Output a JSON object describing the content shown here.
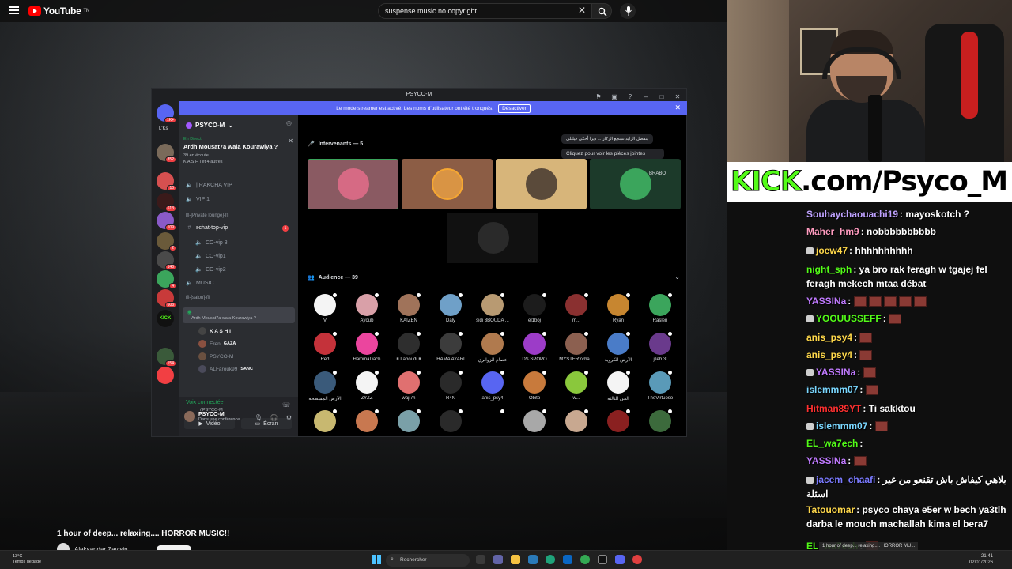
{
  "youtube": {
    "logo_text": "YouTube",
    "logo_tm": "TN",
    "search_value": "suspense music no copyright",
    "video_title": "1 hour of deep... relaxing.... HORROR MUSIC!!",
    "channel_name": "Aleksandar Zavisin"
  },
  "discord": {
    "window_title": "PSYCO-M",
    "banner_text": "Le mode streamer est activé. Les noms d'utilisateur ont été tronqués.",
    "banner_button": "Désactiver",
    "server_name": "PSYCO-M",
    "server_label": "L'Ks",
    "event_live": "En Direct",
    "event_title": "Ardh Mousat7a wala Kourawiya ?",
    "event_listening": "39 en écoute",
    "event_others": "K A S H I et 4 autres",
    "channels": [
      {
        "icon": "speaker",
        "label": "| RAKCHA VIP"
      },
      {
        "icon": "speaker",
        "label": "VIP 1"
      },
      {
        "icon": "category",
        "label": "ᗰ-[Private lounge]-ᗰ"
      },
      {
        "icon": "hash",
        "label": "ʚchat-top-vip",
        "badge": "1"
      },
      {
        "icon": "speaker",
        "label": "CO-vip 3"
      },
      {
        "icon": "speaker",
        "label": "CO-vip1"
      },
      {
        "icon": "speaker",
        "label": "CO-vip2"
      },
      {
        "icon": "speaker",
        "label": "MUSIC"
      },
      {
        "icon": "category",
        "label": "ᗰ-[salon]-ᗰ"
      }
    ],
    "stage_channel": "Ardh Mousat7a wala Kourawiya ?",
    "voice_users": [
      "K A S H I",
      "Eren",
      "PSYCO-M",
      "ALFarouk99"
    ],
    "voice_user_tags": {
      "Eren": "GAZA",
      "ALFarouk99": "SANC"
    },
    "voice_status": "Voix connectée",
    "voice_location": "/ PSYCO-M",
    "video_label": "Vidéo",
    "screen_label": "Écran",
    "user_name": "PSYCO-M",
    "user_status": "Dans une conférence",
    "speakers_title": "Intervenants — 5",
    "audience_title": "Audience — 39",
    "tooltip_arabic": "بتفصل الزايد تشجع الركاز ... ديرا أحكي فيلتلي",
    "tooltip_attach": "Cliquez pour voir les pièces jointes",
    "brabo_label": "BRABO",
    "audience": [
      {
        "name": "V",
        "color": "#f4f4f4"
      },
      {
        "name": "Ayoub",
        "color": "#d9a0a8"
      },
      {
        "name": "KAIZEN",
        "color": "#a0735a"
      },
      {
        "name": "Daly",
        "color": "#6fa0c8"
      },
      {
        "name": "sidi 3BOUDA ...",
        "color": "#b89a72"
      },
      {
        "name": "el1boj",
        "color": "#1c1c1c"
      },
      {
        "name": "m...",
        "color": "#8a3030"
      },
      {
        "name": "Ryan",
        "color": "#c78630"
      },
      {
        "name": "Raslen",
        "color": "#3ba55c"
      },
      {
        "name": "Red",
        "color": "#c4323a"
      },
      {
        "name": "HammaDach",
        "color": "#eb459e"
      },
      {
        "name": "¥ Laboudi ¥",
        "color": "#2e2e2e"
      },
      {
        "name": "HAMA AYARI",
        "color": "#3c3c3c"
      },
      {
        "name": "عصام الزوابري",
        "color": "#b07a4e"
      },
      {
        "name": "DS SPOPO",
        "color": "#9c3cc8"
      },
      {
        "name": "MYSTERYcha...",
        "color": "#8c6050"
      },
      {
        "name": "الأرض الكروية",
        "color": "#4a7cc8"
      },
      {
        "name": "jlleb 3l",
        "color": "#6a3a8c"
      },
      {
        "name": "الأرض المسطحة",
        "color": "#3a5a7a"
      },
      {
        "name": "ZYZZ",
        "color": "#f4f4f4"
      },
      {
        "name": "waji7h",
        "color": "#e07070"
      },
      {
        "name": "R4N",
        "color": "#2a2a2a"
      },
      {
        "name": "anis_psy4",
        "color": "#5865f2"
      },
      {
        "name": "Obito",
        "color": "#c87a3c"
      },
      {
        "name": "w...",
        "color": "#8ac83c"
      },
      {
        "name": "الجن الثالثة",
        "color": "#f4f4f4"
      },
      {
        "name": "TheVirtuoso",
        "color": "#5a9ab8"
      },
      {
        "name": "",
        "color": "#c8b870"
      },
      {
        "name": "",
        "color": "#c87850"
      },
      {
        "name": "",
        "color": "#7aa0a8"
      },
      {
        "name": "",
        "color": "#2a2a2a"
      },
      {
        "name": "",
        "color": "#000000"
      },
      {
        "name": "",
        "color": "#a8a8a8"
      },
      {
        "name": "",
        "color": "#c8a890"
      },
      {
        "name": "",
        "color": "#8a2020"
      },
      {
        "name": "",
        "color": "#3c6a3c"
      }
    ]
  },
  "kick_banner": {
    "green": "KICK",
    "black": ".com/Psyco_M"
  },
  "chat": [
    {
      "user": "Souhaychaouachi19",
      "color": "#bfa2ff",
      "text": ": mayoskotch ?"
    },
    {
      "user": "Maher_hm9",
      "color": "#ff9bbf",
      "text": ": nobbbbbbbbbb"
    },
    {
      "user": "joew47",
      "color": "#ffd84a",
      "text": ": hhhhhhhhhh"
    },
    {
      "user": "night_sph",
      "color": "#53fc18",
      "text": ": ya bro rak feragh w tgajej fel feragh mekech mtaa débat"
    },
    {
      "user": "YASSINa",
      "color": "#c07aff",
      "text": ":"
    },
    {
      "user": "YOOUUSSEFF",
      "color": "#53fc18",
      "text": ":"
    },
    {
      "user": "anis_psy4",
      "color": "#ffd84a",
      "text": ":"
    },
    {
      "user": "anis_psy4",
      "color": "#ffd84a",
      "text": ":"
    },
    {
      "user": "YASSINa",
      "color": "#c07aff",
      "text": ":"
    },
    {
      "user": "islemmm07",
      "color": "#7ad7ff",
      "text": ":"
    },
    {
      "user": "Hitman89YT",
      "color": "#ff3030",
      "text": ": Ti sakktou"
    },
    {
      "user": "islemmm07",
      "color": "#7ad7ff",
      "text": ":"
    },
    {
      "user": "EL_wa7ech",
      "color": "#53fc18",
      "text": ":"
    },
    {
      "user": "YASSINa",
      "color": "#c07aff",
      "text": ":"
    },
    {
      "user": "jacem_chaafi",
      "color": "#7a7aff",
      "text": ": بلاهي كيفاش باش تقنعو من غير اسئلة"
    },
    {
      "user": "Tatouomar",
      "color": "#ffd84a",
      "text": ": psyco chaya e5er w bech ya3tlh darba le mouch machallah kima el bera7"
    },
    {
      "user": "EL_wa7ech",
      "color": "#53fc18",
      "text": ":"
    }
  ],
  "taskbar": {
    "temp": "13°C",
    "weather": "Temps dégagé",
    "search_placeholder": "Rechercher",
    "time": "21:41",
    "date": "02/01/2026",
    "media_title": "1 hour of deep... relaxing.... HORROR MU..."
  }
}
